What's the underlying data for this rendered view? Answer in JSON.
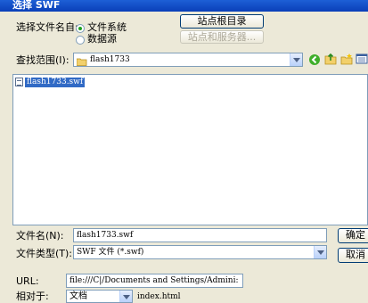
{
  "window": {
    "title": "选择 SWF"
  },
  "source_select": {
    "label": "选择文件名自:",
    "options": [
      "文件系统",
      "数据源"
    ],
    "selected": "文件系统"
  },
  "buttons": {
    "site_root": "站点根目录",
    "site_server": "站点和服务器...",
    "ok": "确定",
    "cancel": "取消"
  },
  "lookin": {
    "label": "查找范围(I):",
    "value": "flash1733"
  },
  "file_list": [
    {
      "name": "flash1733.swf",
      "selected": true
    }
  ],
  "filename": {
    "label": "文件名(N):",
    "value": "flash1733.swf"
  },
  "filetype": {
    "label": "文件类型(T):",
    "value": "SWF 文件 (*.swf)"
  },
  "url": {
    "label": "URL:",
    "value": "file:///C|/Documents and Settings/Admini:"
  },
  "relative": {
    "label": "相对于:",
    "value": "文档",
    "doc_name": "index.html"
  },
  "colors": {
    "title_bar": "#0a3fb8",
    "selection": "#316ac5",
    "dialog_bg": "#ece9d8"
  },
  "icons": [
    "back-icon",
    "up-folder-icon",
    "new-folder-icon",
    "view-menu-icon",
    "folder-icon",
    "swf-file-icon"
  ]
}
